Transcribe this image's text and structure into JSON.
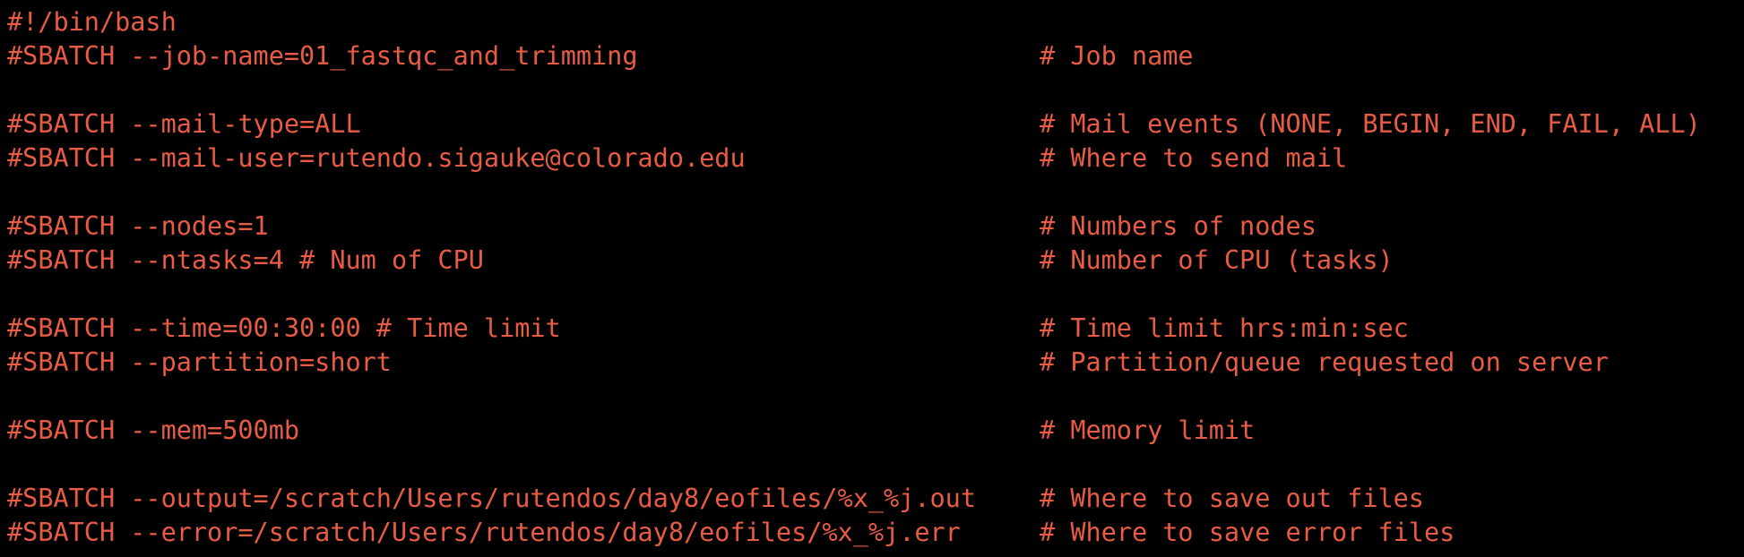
{
  "terminal": {
    "text_color": "#e85c45",
    "background": "#000000",
    "lines": [
      {
        "code": "#!/bin/bash",
        "comment": ""
      },
      {
        "code": "#SBATCH --job-name=01_fastqc_and_trimming",
        "comment": "# Job name"
      },
      {
        "code": "",
        "comment": ""
      },
      {
        "code": "#SBATCH --mail-type=ALL",
        "comment": "# Mail events (NONE, BEGIN, END, FAIL, ALL)"
      },
      {
        "code": "#SBATCH --mail-user=rutendo.sigauke@colorado.edu",
        "comment": "# Where to send mail"
      },
      {
        "code": "",
        "comment": ""
      },
      {
        "code": "#SBATCH --nodes=1",
        "comment": "# Numbers of nodes"
      },
      {
        "code": "#SBATCH --ntasks=4 # Num of CPU",
        "comment": "# Number of CPU (tasks)"
      },
      {
        "code": "",
        "comment": ""
      },
      {
        "code": "#SBATCH --time=00:30:00 # Time limit",
        "comment": "# Time limit hrs:min:sec"
      },
      {
        "code": "#SBATCH --partition=short",
        "comment": "# Partition/queue requested on server"
      },
      {
        "code": "",
        "comment": ""
      },
      {
        "code": "#SBATCH --mem=500mb",
        "comment": "# Memory limit"
      },
      {
        "code": "",
        "comment": ""
      },
      {
        "code": "#SBATCH --output=/scratch/Users/rutendos/day8/eofiles/%x_%j.out",
        "comment": "# Where to save out files"
      },
      {
        "code": "#SBATCH --error=/scratch/Users/rutendos/day8/eofiles/%x_%j.err",
        "comment": "# Where to save error files"
      }
    ]
  }
}
